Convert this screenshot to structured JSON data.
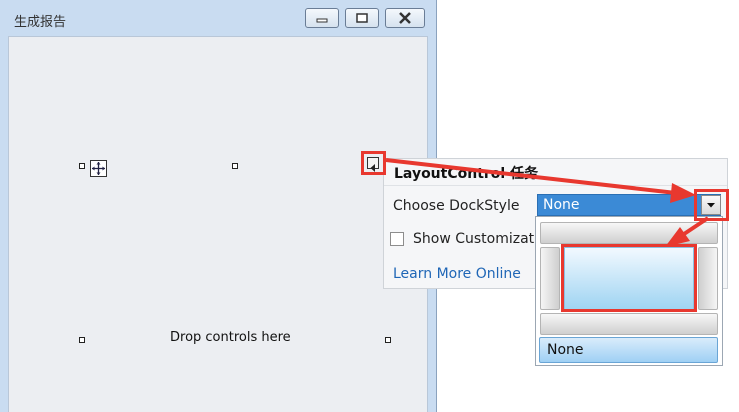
{
  "window": {
    "title": "生成报告"
  },
  "designer": {
    "drop_hint": "Drop controls here"
  },
  "smart_panel": {
    "title": "LayoutControl 任务",
    "dock_label": "Choose DockStyle",
    "dock_value": "None",
    "show_customization": "Show Customizat",
    "learn_more": "Learn More Online"
  },
  "dropdown": {
    "selected_option": "None"
  },
  "colors": {
    "annotation": "#e8382f",
    "selection": "#3b8ad6",
    "link": "#1f66b6"
  }
}
